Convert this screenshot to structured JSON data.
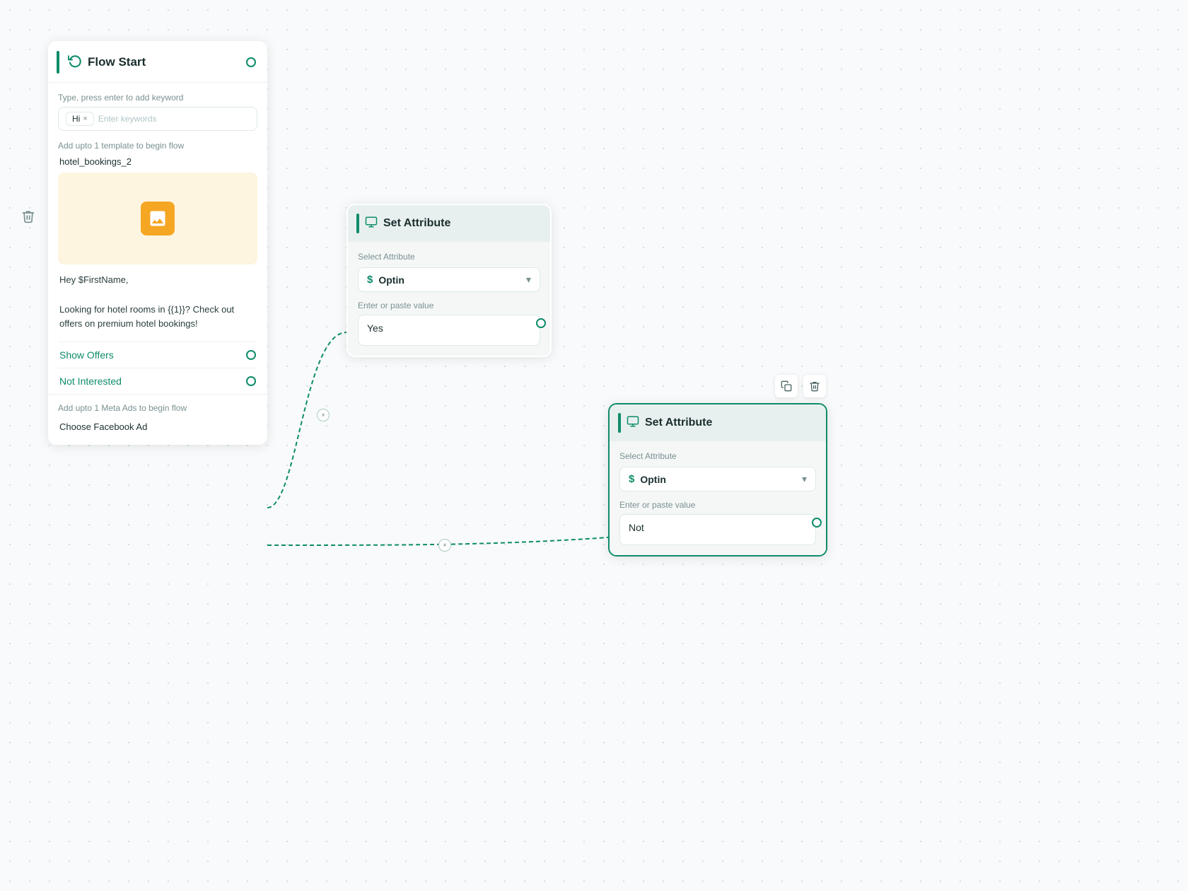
{
  "flow_start": {
    "title": "Flow Start",
    "header_dot_visible": true,
    "keyword_section_label": "Type, press enter to add keyword",
    "keyword_tag": "Hi",
    "keyword_input_placeholder": "Enter keywords",
    "template_section_label": "Add upto 1 template to begin flow",
    "template_name": "hotel_bookings_2",
    "template_message_line1": "Hey $FirstName,",
    "template_message_line2": "Looking for hotel rooms in {{1}}? Check out offers on premium hotel bookings!",
    "button_show_offers": "Show Offers",
    "button_not_interested": "Not Interested",
    "meta_ads_label": "Add upto 1 Meta Ads to begin flow",
    "choose_fb_ad": "Choose Facebook Ad"
  },
  "set_attribute_1": {
    "title": "Set Attribute",
    "select_attribute_label": "Select Attribute",
    "attribute_value": "Optin",
    "value_label": "Enter or paste value",
    "value_text": "Yes"
  },
  "set_attribute_2": {
    "title": "Set Attribute",
    "select_attribute_label": "Select Attribute",
    "attribute_value": "Optin",
    "value_label": "Enter or paste value",
    "value_text": "Not"
  },
  "icons": {
    "flow_start": "↻",
    "set_attribute": "☰",
    "delete": "🗑",
    "copy": "⧉",
    "dollar": "$",
    "chevron_down": "▾",
    "x_mark": "×"
  },
  "colors": {
    "accent": "#0e8c6a",
    "dot_border": "#0e8c6a",
    "card_bg": "#ffffff",
    "attr_header_bg": "#e8f0ef",
    "attr_body_bg": "#f5f7f7",
    "template_image_bg": "#fdf5e0",
    "image_icon_bg": "#f5a623",
    "highlighted_border": "#0e8c6a"
  }
}
